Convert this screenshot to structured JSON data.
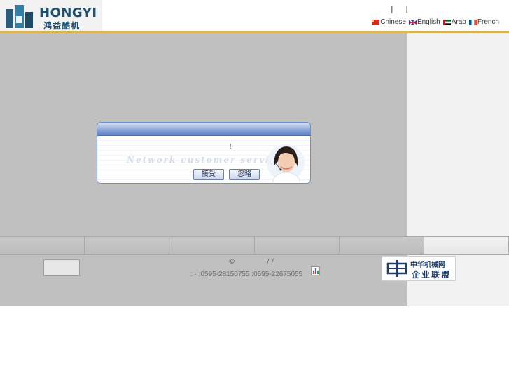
{
  "header": {
    "logo_en": "HONGYI",
    "logo_cn": "鸿益酷机",
    "top_links": [
      "|",
      "|"
    ],
    "languages": [
      {
        "label": "Chinese",
        "flag": "cn-flag-icon"
      },
      {
        "label": "English",
        "flag": "uk-flag-icon"
      },
      {
        "label": "Arab",
        "flag": "uae-flag-icon"
      },
      {
        "label": "French",
        "flag": "france-flag-icon"
      }
    ]
  },
  "dialog": {
    "message": "!",
    "watermark": "Network customer service",
    "accept_label": "接受",
    "ignore_label": "忽略"
  },
  "footer": {
    "copyright": "©",
    "slashes": "/   /",
    "contact": ":  ·     :0595-28150755       :0595-22675055",
    "alliance_line1": "中华机械网",
    "alliance_line2": "企业联盟"
  },
  "colors": {
    "accent_line": "#d8b64d",
    "overlay": "#c0c0c0",
    "dialog_border": "#6f8fc8"
  }
}
